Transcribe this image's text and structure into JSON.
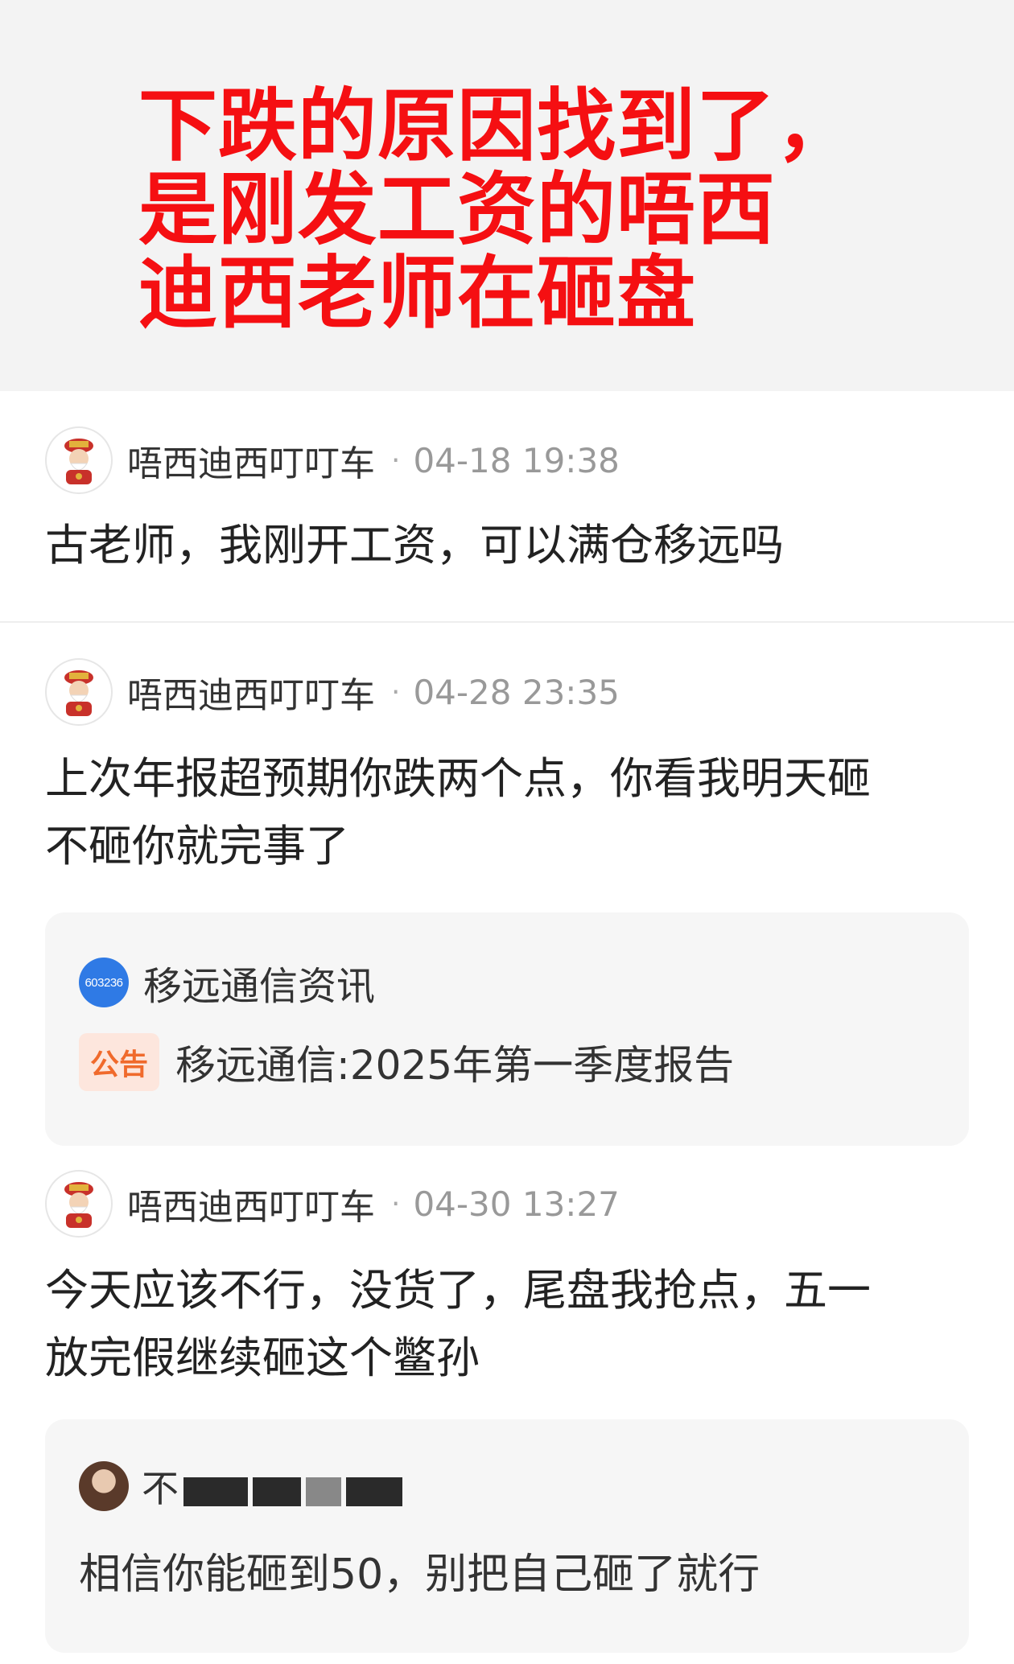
{
  "banner": {
    "headline_lines": [
      "下跌的原因找到了，",
      "是刚发工资的唔西",
      "迪西老师在砸盘"
    ]
  },
  "posts": [
    {
      "username": "唔西迪西叮叮车",
      "time": "04-18 19:38",
      "content_lines": [
        "古老师，我刚开工资，可以满仓移远吗"
      ]
    },
    {
      "username": "唔西迪西叮叮车",
      "time": "04-28 23:35",
      "content_lines": [
        "上次年报超预期你跌两个点，你看我明天砸",
        "不砸你就完事了"
      ],
      "card": {
        "source_logo_text": "603236",
        "source_name": "移远通信资讯",
        "badge": "公告",
        "title": "移远通信:2025年第一季度报告"
      }
    },
    {
      "username": "唔西迪西叮叮车",
      "time": "04-30 13:27",
      "content_lines": [
        "今天应该不行，没货了，尾盘我抢点，五一",
        "放完假继续砸这个鳖孙"
      ],
      "reply": {
        "username_visible": "不",
        "text": "相信你能砸到50，别把自己砸了就行"
      }
    }
  ],
  "colors": {
    "headline": "#f50f12",
    "banner_bg": "#f3f3f3",
    "card_bg": "#f6f6f6",
    "badge_text": "#f06a2c",
    "badge_bg": "#fde6dd",
    "source_logo": "#2f7ae5"
  }
}
